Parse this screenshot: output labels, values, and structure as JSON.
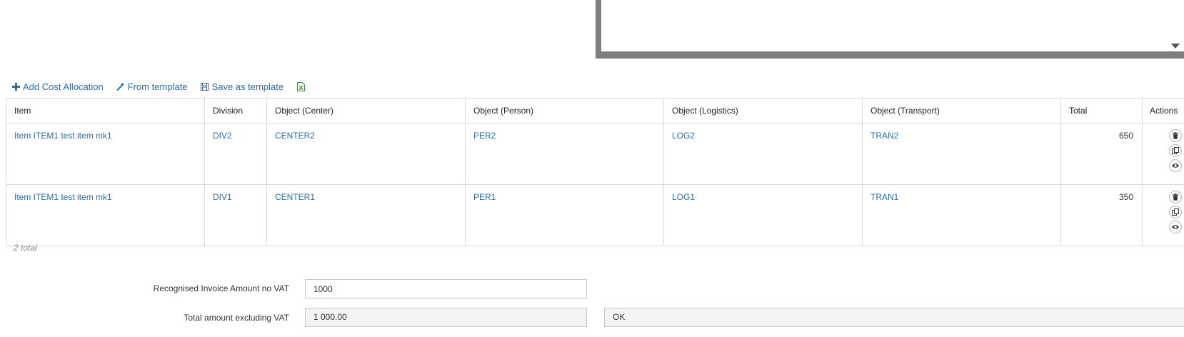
{
  "toolbar": {
    "add_label": "Add Cost Allocation",
    "from_template_label": "From template",
    "save_template_label": "Save as template"
  },
  "table": {
    "headers": [
      "Item",
      "Division",
      "Object (Center)",
      "Object (Person)",
      "Object (Logistics)",
      "Object (Transport)",
      "Total",
      "Actions"
    ],
    "rows": [
      {
        "item": "Item ITEM1 test item mk1",
        "division": "DIV2",
        "center": "CENTER2",
        "person": "PER2",
        "logistics": "LOG2",
        "transport": "TRAN2",
        "total": "650"
      },
      {
        "item": "Item ITEM1 test item mk1",
        "division": "DIV1",
        "center": "CENTER1",
        "person": "PER1",
        "logistics": "LOG1",
        "transport": "TRAN1",
        "total": "350"
      }
    ],
    "count_label": "2 total"
  },
  "form": {
    "recognised_label": "Recognised Invoice Amount no VAT",
    "recognised_value": "1000",
    "total_excl_label": "Total amount excluding VAT",
    "total_excl_value": "1 000.00",
    "status_value": "OK"
  },
  "colors": {
    "link": "#2a6ea6",
    "border": "#d9d9d9",
    "readonly_bg": "#f3f3f3"
  }
}
